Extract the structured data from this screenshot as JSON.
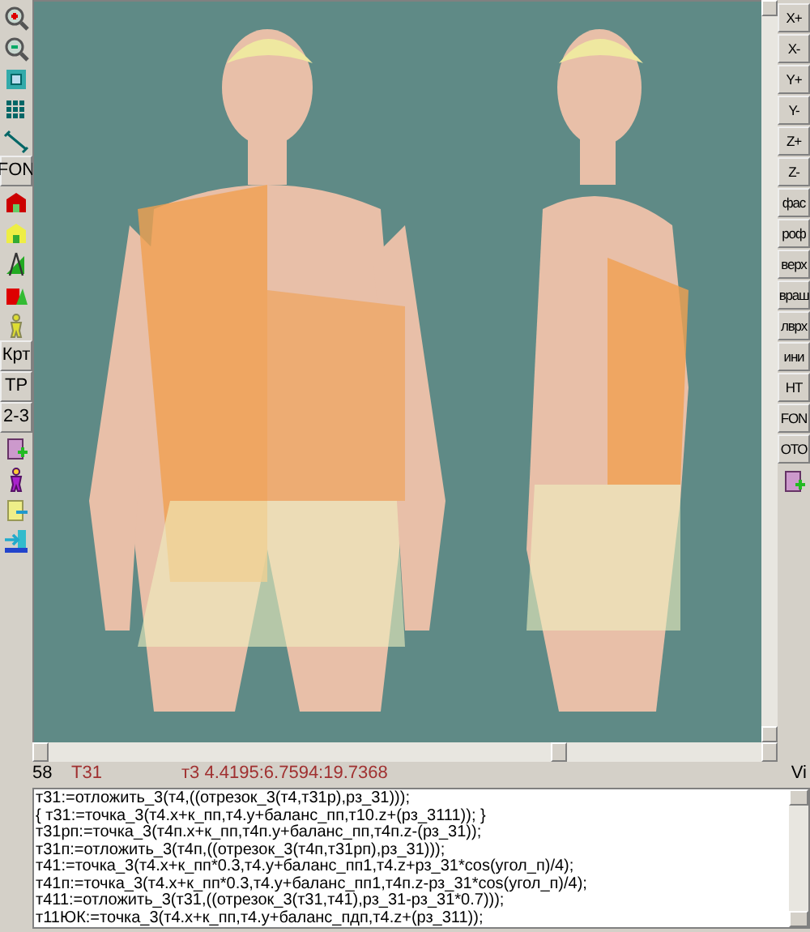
{
  "left_toolbar": [
    {
      "kind": "icon"
    },
    {
      "kind": "icon"
    },
    {
      "kind": "icon"
    },
    {
      "kind": "icon"
    },
    {
      "kind": "icon"
    },
    {
      "kind": "text",
      "label": "FON"
    },
    {
      "kind": "icon"
    },
    {
      "kind": "icon"
    },
    {
      "kind": "icon"
    },
    {
      "kind": "icon"
    },
    {
      "kind": "icon"
    },
    {
      "kind": "text",
      "label": "Крт"
    },
    {
      "kind": "text",
      "label": "ТР"
    },
    {
      "kind": "text",
      "label": "2-3"
    },
    {
      "kind": "icon"
    },
    {
      "kind": "icon"
    },
    {
      "kind": "icon"
    },
    {
      "kind": "icon"
    }
  ],
  "right_toolbar": [
    {
      "kind": "text",
      "label": "X+"
    },
    {
      "kind": "text",
      "label": "X-"
    },
    {
      "kind": "text",
      "label": "Y+"
    },
    {
      "kind": "text",
      "label": "Y-"
    },
    {
      "kind": "text",
      "label": "Z+"
    },
    {
      "kind": "text",
      "label": "Z-"
    },
    {
      "kind": "text",
      "label": "фас"
    },
    {
      "kind": "text",
      "label": "роф"
    },
    {
      "kind": "text",
      "label": "верх"
    },
    {
      "kind": "text",
      "label": "враш"
    },
    {
      "kind": "text",
      "label": "лврх"
    },
    {
      "kind": "text",
      "label": "ини"
    },
    {
      "kind": "text",
      "label": "НТ"
    },
    {
      "kind": "text",
      "label": "FON"
    },
    {
      "kind": "text",
      "label": "ОТО"
    },
    {
      "kind": "icon"
    }
  ],
  "status_bar": {
    "line": "58",
    "point": "Т31",
    "coordinates": "т3 4.4195:6.7594:19.7368",
    "mode": "Vi"
  },
  "editor": {
    "lines": [
      "т31:=отложить_3(т4,((отрезок_3(т4,т31р),рз_31)));",
      "{ т31:=точка_3(т4.x+к_пп,т4.y+баланс_пп,т10.z+(рз_3111)); }",
      "т31рп:=точка_3(т4п.x+к_пп,т4п.y+баланс_пп,т4п.z-(рз_31));",
      "т31п:=отложить_3(т4п,((отрезок_3(т4п,т31рп),рз_31)));",
      "т41:=точка_3(т4.x+к_пп*0.3,т4.y+баланс_пп1,т4.z+рз_31*cos(угол_п)/4);",
      "т41п:=точка_3(т4.x+к_пп*0.3,т4.y+баланс_пп1,т4п.z-рз_31*cos(угол_п)/4);",
      "т411:=отложить_3(т31,((отрезок_3(т31,т41),рз_31-рз_31*0.7)));",
      "т11ЮК:=точка_3(т4.x+к_пп,т4.y+баланс_пдп,т4.z+(рз_311));"
    ]
  }
}
